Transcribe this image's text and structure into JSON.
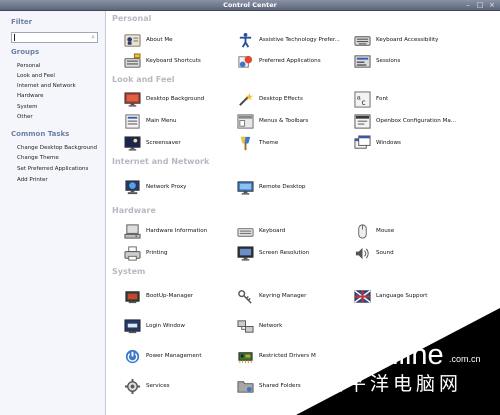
{
  "window": {
    "title": "Control Center"
  },
  "sidebar": {
    "filter_heading": "Filter",
    "filter_value": "",
    "groups_heading": "Groups",
    "groups": [
      "Personal",
      "Look and Feel",
      "Internet and Network",
      "Hardware",
      "System",
      "Other"
    ],
    "tasks_heading": "Common Tasks",
    "tasks": [
      "Change Desktop Background",
      "Change Theme",
      "Set Preferred Applications",
      "Add Printer"
    ]
  },
  "sections": [
    {
      "title": "Personal",
      "items": [
        "About Me",
        "Assistive Technology Prefer...",
        "Keyboard Accessibility",
        "Keyboard Shortcuts",
        "Preferred Applications",
        "Sessions"
      ]
    },
    {
      "title": "Look and Feel",
      "items": [
        "Desktop Background",
        "Desktop Effects",
        "Font",
        "Main Menu",
        "Menus & Toolbars",
        "Openbox Configuration Ma...",
        "Screensaver",
        "Theme",
        "Windows"
      ]
    },
    {
      "title": "Internet and Network",
      "items": [
        "Network Proxy",
        "Remote Desktop"
      ]
    },
    {
      "title": "Hardware",
      "items": [
        "Hardware Information",
        "Keyboard",
        "Mouse",
        "Printing",
        "Screen Resolution",
        "Sound"
      ]
    },
    {
      "title": "System",
      "items": [
        "BootUp-Manager",
        "Keyring Manager",
        "Language Support",
        "Login Window",
        "Network",
        "Power Management",
        "Restricted Drivers M",
        "Services",
        "Shared Folders"
      ]
    }
  ],
  "watermark": {
    "brand": "PConline",
    "domain": ".com.cn",
    "cn": "太平洋电脑网"
  },
  "icons": {
    "About Me": "user-card-icon",
    "Assistive Technology Prefer...": "accessibility-icon",
    "Keyboard Accessibility": "keyboard-icon",
    "Keyboard Shortcuts": "keyboard-shortcuts-icon",
    "Preferred Applications": "preferred-apps-icon",
    "Sessions": "sessions-icon",
    "Desktop Background": "desktop-background-icon",
    "Desktop Effects": "desktop-effects-icon",
    "Font": "font-icon",
    "Main Menu": "main-menu-icon",
    "Menus & Toolbars": "menus-toolbars-icon",
    "Openbox Configuration Ma...": "openbox-icon",
    "Screensaver": "screensaver-icon",
    "Theme": "theme-icon",
    "Windows": "windows-icon",
    "Network Proxy": "network-proxy-icon",
    "Remote Desktop": "remote-desktop-icon",
    "Hardware Information": "hardware-info-icon",
    "Keyboard": "keyboard-icon",
    "Mouse": "mouse-icon",
    "Printing": "printer-icon",
    "Screen Resolution": "screen-resolution-icon",
    "Sound": "sound-icon",
    "BootUp-Manager": "bootup-manager-icon",
    "Keyring Manager": "keyring-icon",
    "Language Support": "language-support-icon",
    "Login Window": "login-window-icon",
    "Network": "network-icon",
    "Power Management": "power-management-icon",
    "Restricted Drivers M": "restricted-drivers-icon",
    "Services": "services-icon",
    "Shared Folders": "shared-folders-icon"
  },
  "colors": {
    "titlebar": "#6f7891",
    "section_title": "#b6b9c1",
    "side_heading": "#6f7fa6"
  }
}
